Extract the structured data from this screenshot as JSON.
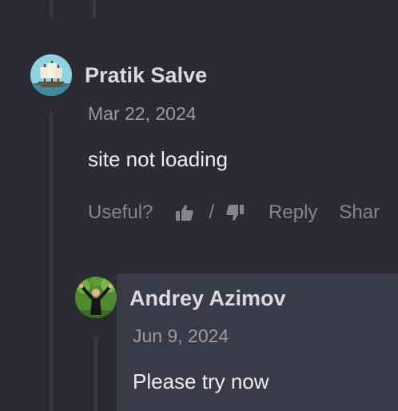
{
  "comment": {
    "author": "Pratik Salve",
    "avatar_icon": "ship-avatar",
    "date": "Mar 22, 2024",
    "text": "site not loading",
    "actions": {
      "useful_label": "Useful?",
      "separator": "/",
      "reply_label": "Reply",
      "share_label": "Shar"
    }
  },
  "reply": {
    "author": "Andrey Azimov",
    "avatar_icon": "person-raised-arms-avatar",
    "date": "Jun 9, 2024",
    "text": "Please try now"
  },
  "colors": {
    "background": "#2b2b33",
    "reply_card": "#3a3b49",
    "author_text": "#d9d9de",
    "muted_text": "#9a9aa6"
  }
}
